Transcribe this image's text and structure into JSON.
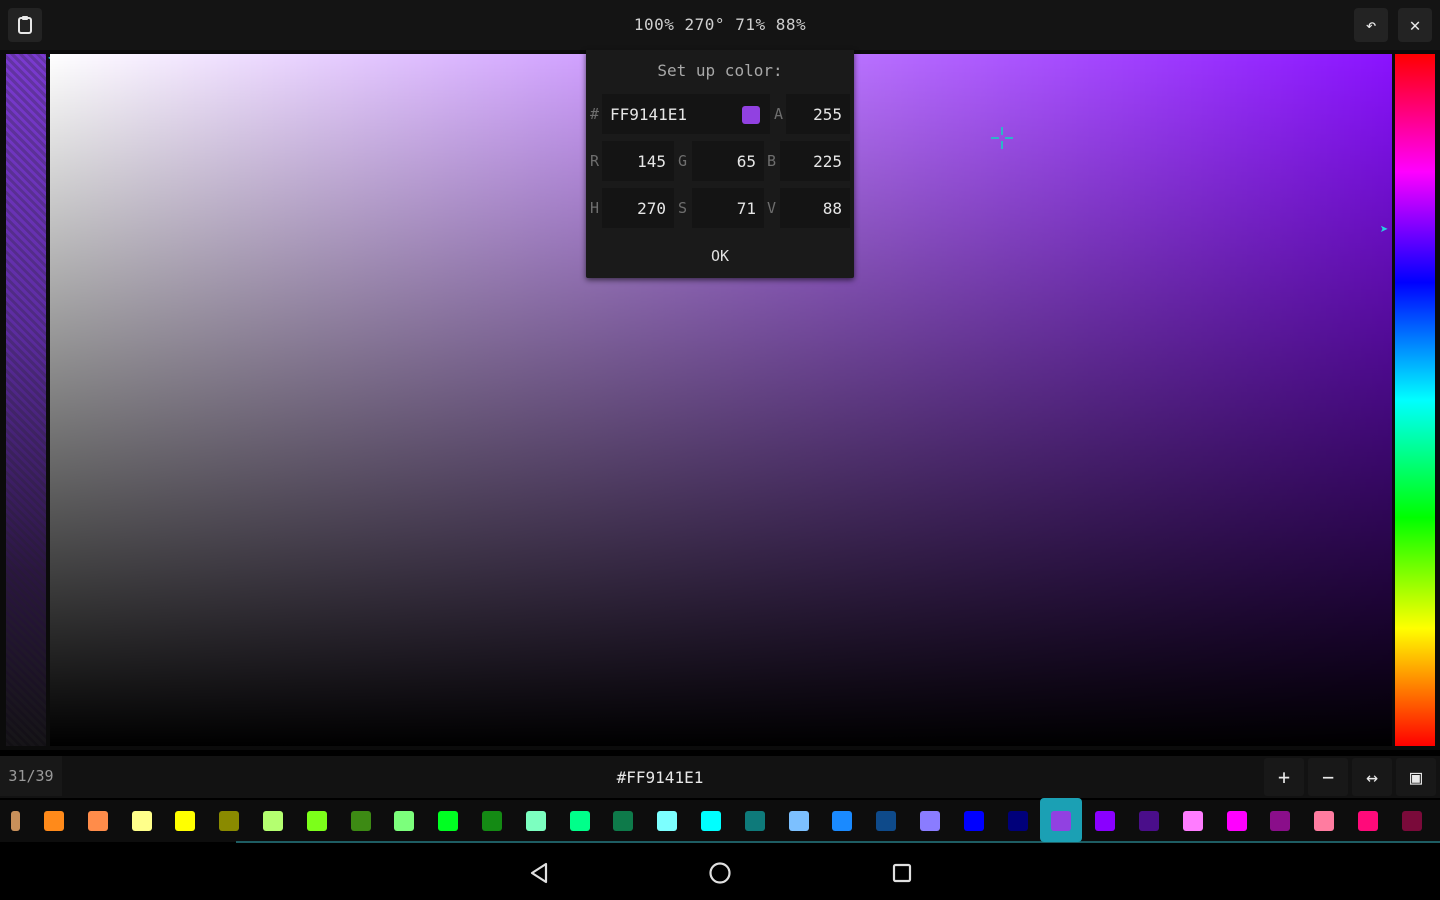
{
  "topbar": {
    "title": "100% 270° 71% 88%",
    "left_icon": "clipboard-icon",
    "undo_icon": "undo-icon",
    "close_icon": "close-icon",
    "close_glyph": "✕",
    "undo_glyph": "↶"
  },
  "picker": {
    "hue_color": "#8a12ff",
    "current_color": "#9141e1"
  },
  "dialog": {
    "title": "Set up color:",
    "hex_label": "#",
    "hex_value": "FF9141E1",
    "a_label": "A",
    "a_value": "255",
    "r_label": "R",
    "r_value": "145",
    "g_label": "G",
    "g_value": "65",
    "b_label": "B",
    "b_value": "225",
    "h_label": "H",
    "h_value": "270",
    "s_label": "S",
    "s_value": "71",
    "v_label": "V",
    "v_value": "88",
    "ok_label": "OK"
  },
  "bottombar": {
    "counter": "31/39",
    "hex": "#FF9141E1",
    "add_glyph": "+",
    "remove_glyph": "−",
    "swap_glyph": "↔",
    "grid_glyph": "▣"
  },
  "palette": {
    "colors": [
      "#c8905a",
      "#ff8a1a",
      "#ff8c4a",
      "#ffff8a",
      "#ffff00",
      "#8a8a00",
      "#b4ff70",
      "#7cff1a",
      "#3d8a14",
      "#7cff7c",
      "#00ff22",
      "#148a14",
      "#7cffc0",
      "#00ff8a",
      "#0e7a4a",
      "#7cffff",
      "#00ffff",
      "#0e7a7a",
      "#7cc0ff",
      "#1a8aff",
      "#0e4a8a",
      "#8a7cff",
      "#0000ff",
      "#00007a",
      "#9141e1",
      "#8a00ff",
      "#4a0e8a",
      "#ff7cff",
      "#ff00ff",
      "#8a0e8a",
      "#ff7ca0",
      "#ff0a7a",
      "#7a0a3a"
    ],
    "selected_index": 24
  }
}
